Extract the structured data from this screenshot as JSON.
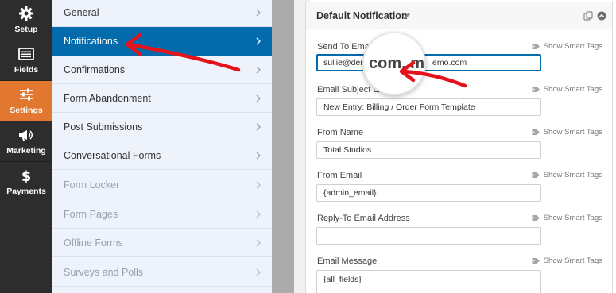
{
  "iconbar": {
    "items": [
      {
        "label": "Setup",
        "icon": "gear-icon"
      },
      {
        "label": "Fields",
        "icon": "fields-list-icon"
      },
      {
        "label": "Settings",
        "icon": "sliders-icon",
        "active": true
      },
      {
        "label": "Marketing",
        "icon": "megaphone-icon"
      },
      {
        "label": "Payments",
        "icon": "dollar-icon"
      }
    ]
  },
  "submenu": {
    "items": [
      {
        "label": "General",
        "state": "normal"
      },
      {
        "label": "Notifications",
        "state": "active"
      },
      {
        "label": "Confirmations",
        "state": "normal"
      },
      {
        "label": "Form Abandonment",
        "state": "normal"
      },
      {
        "label": "Post Submissions",
        "state": "normal"
      },
      {
        "label": "Conversational Forms",
        "state": "normal"
      },
      {
        "label": "Form Locker",
        "state": "disabled"
      },
      {
        "label": "Form Pages",
        "state": "disabled"
      },
      {
        "label": "Offline Forms",
        "state": "disabled"
      },
      {
        "label": "Surveys and Polls",
        "state": "disabled"
      }
    ]
  },
  "panel": {
    "title": "Default Notification",
    "smart_tags_label": "Show Smart Tags",
    "fields": [
      {
        "label": "Send To Email",
        "value": "sullie@dem",
        "value_tail": "emo.com"
      },
      {
        "label": "Email Subject Li",
        "value": "New Entry: Billing / Order Form Template"
      },
      {
        "label": "From Name",
        "value": "Total Studios"
      },
      {
        "label": "From Email",
        "value": "{admin_email}"
      },
      {
        "label": "Reply-To Email Address",
        "value": ""
      },
      {
        "label": "Email Message",
        "value": "{all_fields}"
      }
    ]
  },
  "magnifier": {
    "text": "com, ma"
  },
  "colors": {
    "accent_blue": "#036aab",
    "settings_orange": "#e27730",
    "sidebar_dark": "#2d2d2d",
    "arrow_red": "#e4131b"
  }
}
